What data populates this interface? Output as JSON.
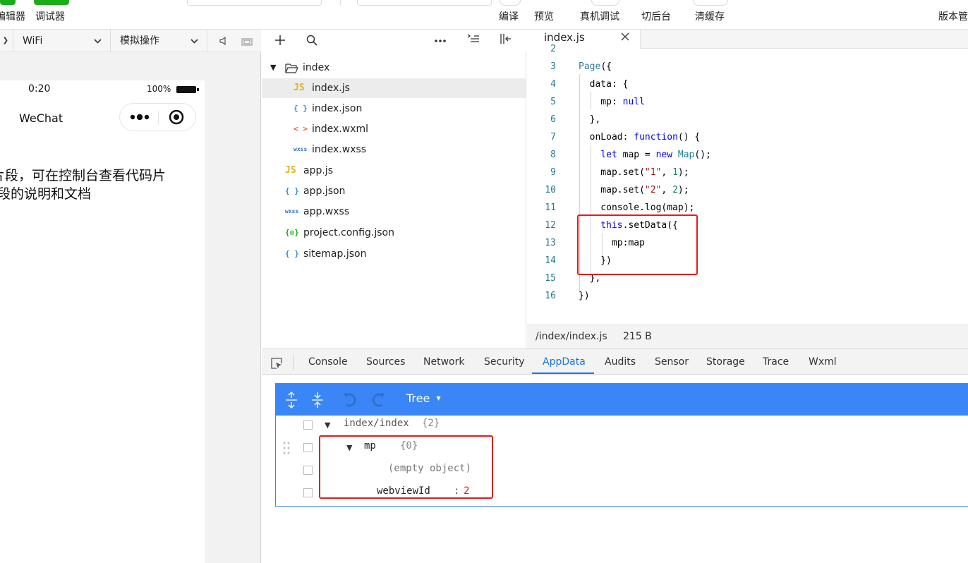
{
  "toolbar": {
    "left_labels": [
      "编辑器",
      "调试器"
    ],
    "right_labels": [
      "编译",
      "预览",
      "真机调试",
      "切后台",
      "清缓存"
    ],
    "version_label": "版本管理"
  },
  "simulator": {
    "network": "WiFi",
    "operation": "模拟操作",
    "status_time": "0:20",
    "battery": "100%",
    "nav_title": "WeChat",
    "body_line1": "代码片段，可在控制台查看代码片",
    "body_line2": "段的说明和文档"
  },
  "explorer": {
    "folder": "index",
    "files": [
      {
        "name": "index.js",
        "icon": "JS",
        "icon_color": "#e2b01e"
      },
      {
        "name": "index.json",
        "icon": "{ }",
        "icon_color": "#2f8fd8"
      },
      {
        "name": "index.wxml",
        "icon": "< >",
        "icon_color": "#e8552f"
      },
      {
        "name": "index.wxss",
        "icon": "wxss",
        "icon_color": "#2f6fc8"
      }
    ],
    "root_files": [
      {
        "name": "app.js",
        "icon": "JS",
        "icon_color": "#e2b01e"
      },
      {
        "name": "app.json",
        "icon": "{ }",
        "icon_color": "#2f8fd8"
      },
      {
        "name": "app.wxss",
        "icon": "wxss",
        "icon_color": "#2f6fc8"
      },
      {
        "name": "project.config.json",
        "icon": "{⚙}",
        "icon_color": "#1aad19"
      },
      {
        "name": "sitemap.json",
        "icon": "{ }",
        "icon_color": "#2f8fd8"
      }
    ]
  },
  "editor": {
    "tab_label": "index.js",
    "line_numbers": [
      "2",
      "3",
      "4",
      "5",
      "6",
      "7",
      "8",
      "9",
      "10",
      "11",
      "12",
      "13",
      "14",
      "15",
      "16"
    ],
    "status_path": "/index/index.js",
    "status_size": "215 B"
  },
  "devtools": {
    "tabs": [
      "Console",
      "Sources",
      "Network",
      "Security",
      "AppData",
      "Audits",
      "Sensor",
      "Storage",
      "Trace",
      "Wxml"
    ],
    "active_tab": "AppData",
    "view_mode": "Tree",
    "tree": {
      "root_key": "index/index",
      "root_count": "{2}",
      "mp_key": "mp",
      "mp_count": "{0}",
      "empty_label": "(empty object)",
      "webview_key": "webviewId",
      "webview_sep": ":",
      "webview_value": "2"
    }
  },
  "colors": {
    "accent_blue": "#3b86f6",
    "highlight_red": "#e8191b",
    "wechat_green": "#1aad19"
  }
}
